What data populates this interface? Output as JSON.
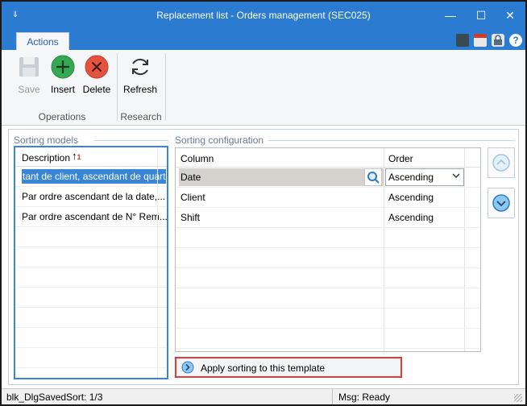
{
  "window": {
    "title": "Replacement list - Orders management (SEC025)",
    "menu_glyph": "⇓",
    "minimize_glyph": "—",
    "maximize_glyph": "☐",
    "close_glyph": "✕"
  },
  "ribbon": {
    "tab_label": "Actions",
    "buttons": {
      "save": "Save",
      "insert": "Insert",
      "delete": "Delete",
      "refresh": "Refresh"
    },
    "groups": {
      "operations": "Operations",
      "research": "Research"
    },
    "right_icons": [
      "calculator-icon",
      "calendar-icon",
      "lock-icon",
      "help-icon"
    ],
    "help_glyph": "?"
  },
  "sorting_models": {
    "title": "Sorting models",
    "header": "Description",
    "rows": [
      "tant de client, ascendant de quart",
      "Par ordre ascendant de la date,...",
      "Par ordre ascendant de N° Rem..."
    ]
  },
  "sorting_configuration": {
    "title": "Sorting configuration",
    "headers": {
      "column": "Column",
      "order": "Order"
    },
    "rows": [
      {
        "column": "Date",
        "order": "Ascending"
      },
      {
        "column": "Client",
        "order": "Ascending"
      },
      {
        "column": "Shift",
        "order": "Ascending"
      }
    ]
  },
  "apply_button": {
    "label": "Apply sorting to this template"
  },
  "status": {
    "left": "blk_DlgSavedSort: 1/3",
    "right": "Msg: Ready"
  },
  "colors": {
    "titlebar": "#2b7bd0",
    "selection": "#3a86d6",
    "highlight_border": "#e53935",
    "insert_green": "#34a853",
    "delete_red": "#e5533f"
  }
}
